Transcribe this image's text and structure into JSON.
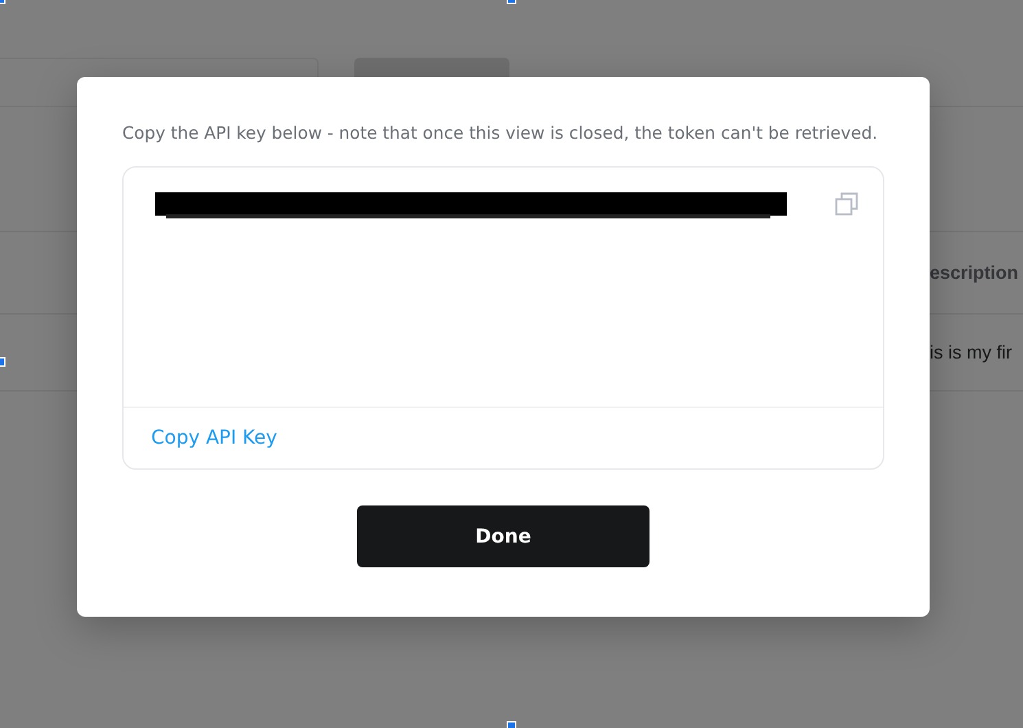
{
  "background_table": {
    "column_header": "escription",
    "cell": "is is my fir"
  },
  "dialog": {
    "message": "Copy the API key below - note that once this view is closed, the token can't be retrieved.",
    "copy_link": "Copy API Key",
    "done_button": "Done"
  }
}
